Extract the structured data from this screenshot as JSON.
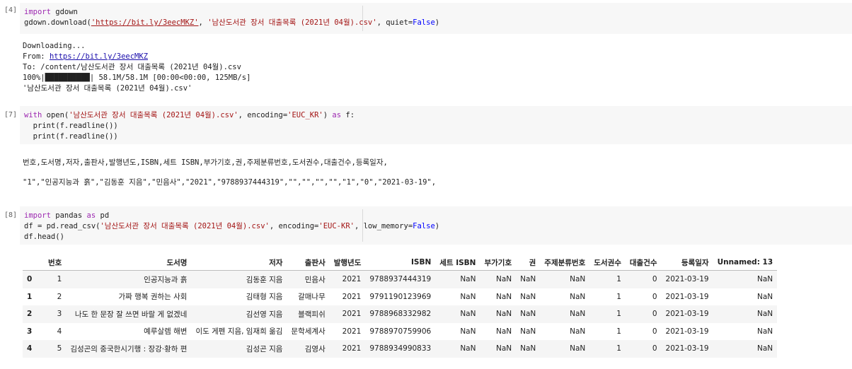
{
  "cells": [
    {
      "prompt": "[4]",
      "code": {
        "l1_kw": "import",
        "l1_rest": " gdown",
        "l2_a": "gdown.download(",
        "l2_url": "'https://bit.ly/3eecMKZ'",
        "l2_b": ", ",
        "l2_file": "'남산도서관 장서 대출목록 (2021년 04월).csv'",
        "l2_c": ", quiet=",
        "l2_false": "False",
        "l2_d": ")"
      },
      "output": {
        "line1": "Downloading...",
        "line2_prefix": "From: ",
        "line2_link": "https://bit.ly/3eecMKZ",
        "line3": "To: /content/남산도서관 장서 대출목록 (2021년 04월).csv",
        "line4": "100%|██████████| 58.1M/58.1M [00:00<00:00, 125MB/s]",
        "line5": "'남산도서관 장서 대출목록 (2021년 04월).csv'"
      }
    },
    {
      "prompt": "[7]",
      "code": {
        "l1_kw": "with",
        "l1_a": " open(",
        "l1_file": "'남산도서관 장서 대출목록 (2021년 04월).csv'",
        "l1_b": ", encoding=",
        "l1_enc": "'EUC_KR'",
        "l1_c": ") ",
        "l1_as": "as",
        "l1_d": " f:",
        "l2": "  print(f.readline())",
        "l3": "  print(f.readline())"
      },
      "output": {
        "line1": "번호,도서명,저자,출판사,발행년도,ISBN,세트 ISBN,부가기호,권,주제분류번호,도서권수,대출건수,등록일자,",
        "line2": "\"1\",\"인공지능과 흙\",\"김동훈 지음\",\"민음사\",\"2021\",\"9788937444319\",\"\",\"\",\"\",\"\",\"1\",\"0\",\"2021-03-19\","
      }
    },
    {
      "prompt": "[8]",
      "code": {
        "l1_kw": "import",
        "l1_a": " pandas ",
        "l1_as": "as",
        "l1_b": " pd",
        "l2_a": "df = pd.read_csv(",
        "l2_file": "'남산도서관 장서 대출목록 (2021년 04월).csv'",
        "l2_b": ", encoding=",
        "l2_enc": "'EUC-KR'",
        "l2_c": ", low_memory=",
        "l2_false": "False",
        "l2_d": ")",
        "l3": "df.head()"
      }
    }
  ],
  "dataframe": {
    "columns": [
      "",
      "번호",
      "도서명",
      "저자",
      "출판사",
      "발행년도",
      "ISBN",
      "세트 ISBN",
      "부가기호",
      "권",
      "주제분류번호",
      "도서권수",
      "대출건수",
      "등록일자",
      "Unnamed: 13"
    ],
    "rows": [
      [
        "0",
        "1",
        "인공지능과 흙",
        "김동훈 지음",
        "민음사",
        "2021",
        "9788937444319",
        "NaN",
        "NaN",
        "NaN",
        "NaN",
        "1",
        "0",
        "2021-03-19",
        "NaN"
      ],
      [
        "1",
        "2",
        "가짜 행복 권하는 사회",
        "김태형 지음",
        "갈매나무",
        "2021",
        "9791190123969",
        "NaN",
        "NaN",
        "NaN",
        "NaN",
        "1",
        "0",
        "2021-03-19",
        "NaN"
      ],
      [
        "2",
        "3",
        "나도 한 문장 잘 쓰면 바랄 게 없겠네",
        "김선영 지음",
        "블랙피쉬",
        "2021",
        "9788968332982",
        "NaN",
        "NaN",
        "NaN",
        "NaN",
        "1",
        "0",
        "2021-03-19",
        "NaN"
      ],
      [
        "3",
        "4",
        "예루살렘 해변",
        "이도 게펜 지음, 임재희 옮김",
        "문학세계사",
        "2021",
        "9788970759906",
        "NaN",
        "NaN",
        "NaN",
        "NaN",
        "1",
        "0",
        "2021-03-19",
        "NaN"
      ],
      [
        "4",
        "5",
        "김성곤의 중국한시기행 : 장강·황하 편",
        "김성곤 지음",
        "김영사",
        "2021",
        "9788934990833",
        "NaN",
        "NaN",
        "NaN",
        "NaN",
        "1",
        "0",
        "2021-03-19",
        "NaN"
      ]
    ]
  }
}
